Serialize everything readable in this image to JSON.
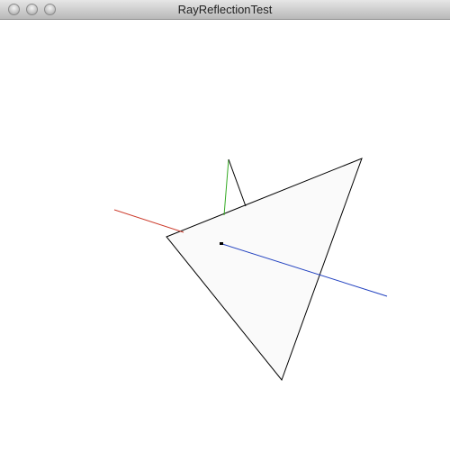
{
  "window": {
    "title": "RayReflectionTest"
  },
  "scene": {
    "triangle_fill": "#fafafa",
    "triangle_stroke": "#000000",
    "incident_ray_color": "#cc3a2a",
    "normal_color": "#33aa22",
    "reflected_ray_color": "#000000",
    "second_ray_color": "#1f3fbf",
    "ray_origin_marker_color": "#000000"
  }
}
